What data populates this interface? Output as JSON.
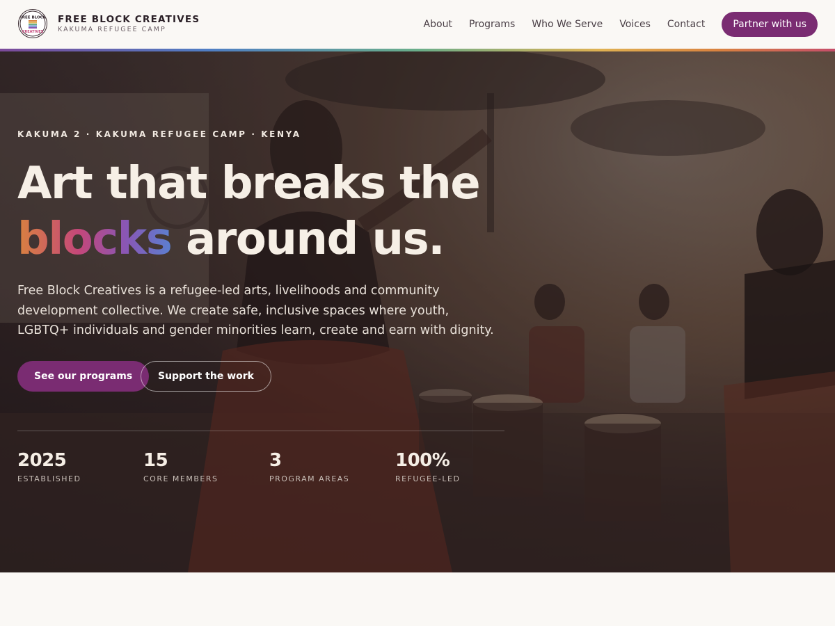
{
  "header": {
    "brand_name": "FREE BLOCK CREATIVES",
    "brand_sub": "KAKUMA REFUGEE CAMP",
    "logo_icon": "free-block-creatives-logo",
    "logo_text_top": "FREE BLOCK",
    "logo_text_bottom": "CREATIVES",
    "nav": [
      {
        "label": "About"
      },
      {
        "label": "Programs"
      },
      {
        "label": "Who We Serve"
      },
      {
        "label": "Voices"
      },
      {
        "label": "Contact"
      }
    ],
    "cta_label": "Partner with us"
  },
  "hero": {
    "eyebrow": "KAKUMA 2 · KAKUMA REFUGEE CAMP · KENYA",
    "headline_line1": "Art that breaks the",
    "headline_accent": "blocks",
    "headline_rest": " around us.",
    "lede": "Free Block Creatives is a refugee-led arts, livelihoods and community development collective. We create safe, inclusive spaces where youth, LGBTQ+ individuals and gender minorities learn, create and earn with dignity.",
    "primary_button": "See our programs",
    "secondary_button": "Support the work",
    "stats": [
      {
        "value": "2025",
        "label": "ESTABLISHED"
      },
      {
        "value": "15",
        "label": "CORE MEMBERS"
      },
      {
        "value": "3",
        "label": "PROGRAM AREAS"
      },
      {
        "value": "100%",
        "label": "REFUGEE-LED"
      }
    ]
  },
  "colors": {
    "brand_purple": "#7a2c72",
    "page_background": "#faf8f5",
    "accent_gradient": [
      "#d9823f",
      "#c4477a",
      "#8a56b4",
      "#5b7fd0"
    ]
  }
}
